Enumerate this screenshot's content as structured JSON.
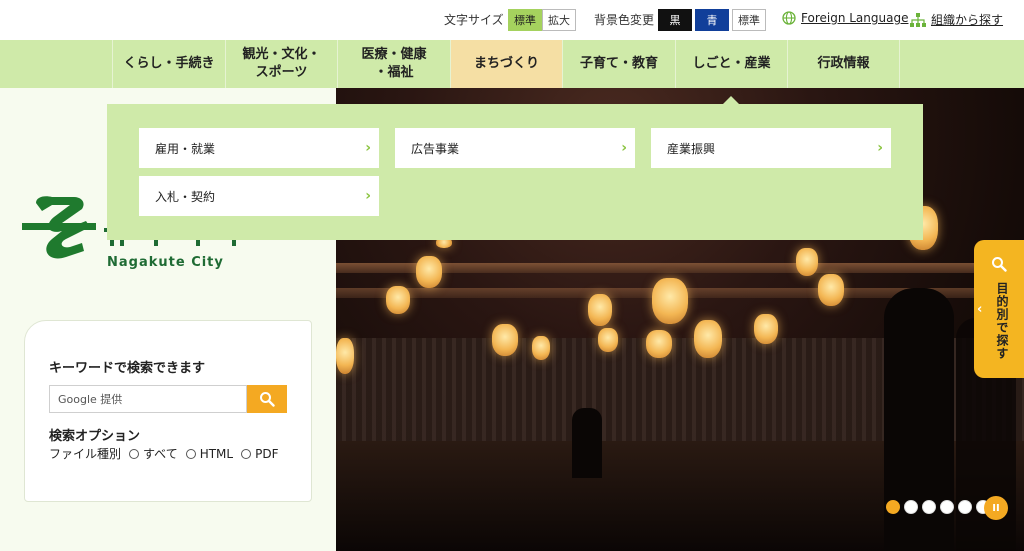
{
  "topbar": {
    "font_size_label": "文字サイズ",
    "font_standard": "標準",
    "font_large": "拡大",
    "bg_label": "背景色変更",
    "bg_black": "黒",
    "bg_blue": "青",
    "bg_standard": "標準",
    "foreign_language": "Foreign Language",
    "org_search": "組織から探す"
  },
  "gnav": {
    "items": [
      {
        "label": "くらし・手続き"
      },
      {
        "label": "観光・文化・\nスポーツ"
      },
      {
        "label": "医療・健康\n・福祉"
      },
      {
        "label": "まちづくり"
      },
      {
        "label": "子育て・教育"
      },
      {
        "label": "しごと・産業"
      },
      {
        "label": "行政情報"
      }
    ]
  },
  "dropdown": {
    "items": [
      {
        "label": "雇用・就業"
      },
      {
        "label": "広告事業"
      },
      {
        "label": "産業振興"
      },
      {
        "label": "入札・契約"
      }
    ]
  },
  "logo": {
    "city_name": "Nagakute City"
  },
  "search": {
    "title": "キーワードで検索できます",
    "placeholder": "Google 提供",
    "options_title": "検索オプション",
    "file_type_label": "ファイル種別",
    "opt_all": "すべて",
    "opt_html": "HTML",
    "opt_pdf": "PDF"
  },
  "side_tab": {
    "label": "目的別で探す"
  },
  "slider": {
    "slide_count": 6,
    "active_slide": 1,
    "pause_label": "II"
  },
  "colors": {
    "nav_green": "#cfeaa9",
    "accent_orange": "#f4a922",
    "active_tab": "#f5dfa4",
    "logo_green": "#1f7a2e"
  }
}
